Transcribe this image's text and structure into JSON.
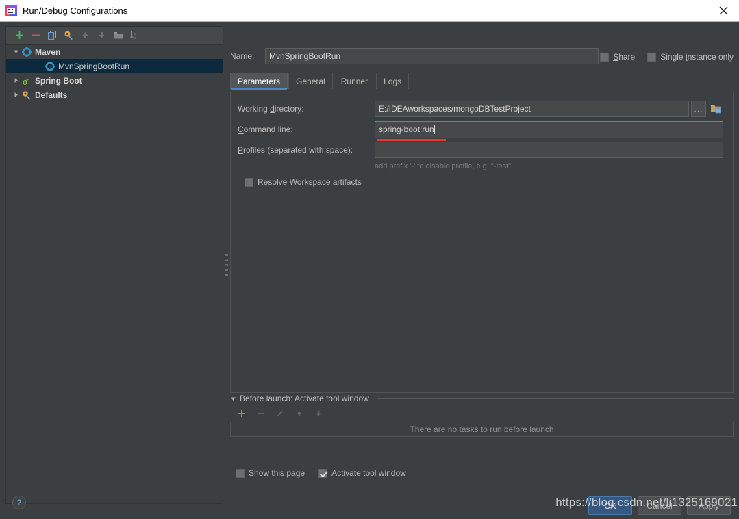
{
  "window": {
    "title": "Run/Debug Configurations",
    "app_icon": "intellij-idea-icon",
    "close_icon": "close-icon"
  },
  "left_panel": {
    "toolbar": [
      {
        "name": "add-configuration-button",
        "icon": "plus-icon",
        "glyph": "+",
        "enabled": true
      },
      {
        "name": "remove-configuration-button",
        "icon": "minus-icon",
        "glyph": "−",
        "enabled": true
      },
      {
        "name": "copy-configuration-button",
        "icon": "copy-icon",
        "glyph": "⧉",
        "enabled": true
      },
      {
        "name": "edit-defaults-button",
        "icon": "wrench-gear-icon",
        "glyph": "⚙",
        "enabled": true
      },
      {
        "name": "move-up-button",
        "icon": "arrow-up-icon",
        "glyph": "↑",
        "enabled": false
      },
      {
        "name": "move-down-button",
        "icon": "arrow-down-icon",
        "glyph": "↓",
        "enabled": false
      },
      {
        "name": "new-folder-button",
        "icon": "folder-icon",
        "glyph": "▭",
        "enabled": false
      },
      {
        "name": "sort-configurations-button",
        "icon": "sort-alphabetically-icon",
        "glyph": "↓",
        "enabled": false
      }
    ],
    "tree": [
      {
        "label": "Maven",
        "level": 0,
        "expanded": true,
        "selected": false,
        "icon": "maven-gear-icon",
        "has_twisty": true
      },
      {
        "label": "MvnSpringBootRun",
        "level": 1,
        "expanded": false,
        "selected": true,
        "icon": "maven-gear-icon",
        "has_twisty": false
      },
      {
        "label": "Spring Boot",
        "level": 0,
        "expanded": false,
        "selected": false,
        "icon": "spring-boot-leaf-icon",
        "has_twisty": true
      },
      {
        "label": "Defaults",
        "level": 0,
        "expanded": false,
        "selected": false,
        "icon": "wrench-gear-icon",
        "has_twisty": true
      }
    ]
  },
  "right_panel": {
    "name_label": "Name:",
    "name_mnemonic": "N",
    "name_value": "MvnSpringBootRun",
    "share_checkbox": {
      "label": "Share",
      "mnemonic": "S",
      "checked": false
    },
    "single_instance_checkbox": {
      "label": "Single instance only",
      "mnemonic": "i",
      "checked": false
    },
    "tabs": [
      {
        "label": "Parameters",
        "active": true
      },
      {
        "label": "General",
        "active": false
      },
      {
        "label": "Runner",
        "active": false
      },
      {
        "label": "Logs",
        "active": false
      }
    ],
    "parameters": {
      "working_directory": {
        "label": "Working directory:",
        "mnemonic": "d",
        "value": "E:/IDEAworkspaces/mongoDBTestProject",
        "browse_button": "...",
        "macro_icon": "folder-insert-macro-icon"
      },
      "command_line": {
        "label": "Command line:",
        "mnemonic": "C",
        "value": "spring-boot:run",
        "focused": true,
        "annotation": "red-underline"
      },
      "profiles": {
        "label": "Profiles (separated with space):",
        "mnemonic": "P",
        "value": "",
        "hint": "add prefix '-' to disable profile, e.g. \"-test\""
      },
      "resolve_workspace_artifacts": {
        "label": "Resolve Workspace artifacts",
        "mnemonic": "W",
        "checked": false
      }
    },
    "before_launch": {
      "title": "Before launch: Activate tool window",
      "expanded": true,
      "toolbar": [
        {
          "name": "add-task-button",
          "icon": "plus-icon",
          "glyph": "+",
          "enabled": true
        },
        {
          "name": "remove-task-button",
          "icon": "minus-icon",
          "glyph": "−",
          "enabled": false
        },
        {
          "name": "edit-task-button",
          "icon": "pencil-icon",
          "glyph": "✎",
          "enabled": false
        },
        {
          "name": "move-task-up-button",
          "icon": "arrow-up-icon",
          "glyph": "↑",
          "enabled": false
        },
        {
          "name": "move-task-down-button",
          "icon": "arrow-down-icon",
          "glyph": "↓",
          "enabled": false
        }
      ],
      "empty_text": "There are no tasks to run before launch",
      "show_this_page": {
        "label": "Show this page",
        "mnemonic": "S",
        "checked": false
      },
      "activate_tool_window": {
        "label": "Activate tool window",
        "mnemonic": "A",
        "checked": true
      }
    }
  },
  "footer": {
    "help_button": "?",
    "ok_button": "OK",
    "cancel_button": "Cancel",
    "apply_button": "Apply"
  },
  "watermark": {
    "text": "https://blog.csdn.net/li1325169021"
  },
  "colors": {
    "dialog_background": "#3c3f41",
    "panel_background": "#45494a",
    "selection_blue": "#0d293e",
    "accent_blue": "#4a88c7",
    "primary_button": "#365880",
    "error_red": "#e8392f",
    "text": "#bbbbbb",
    "titlebar_background": "#ffffff"
  }
}
